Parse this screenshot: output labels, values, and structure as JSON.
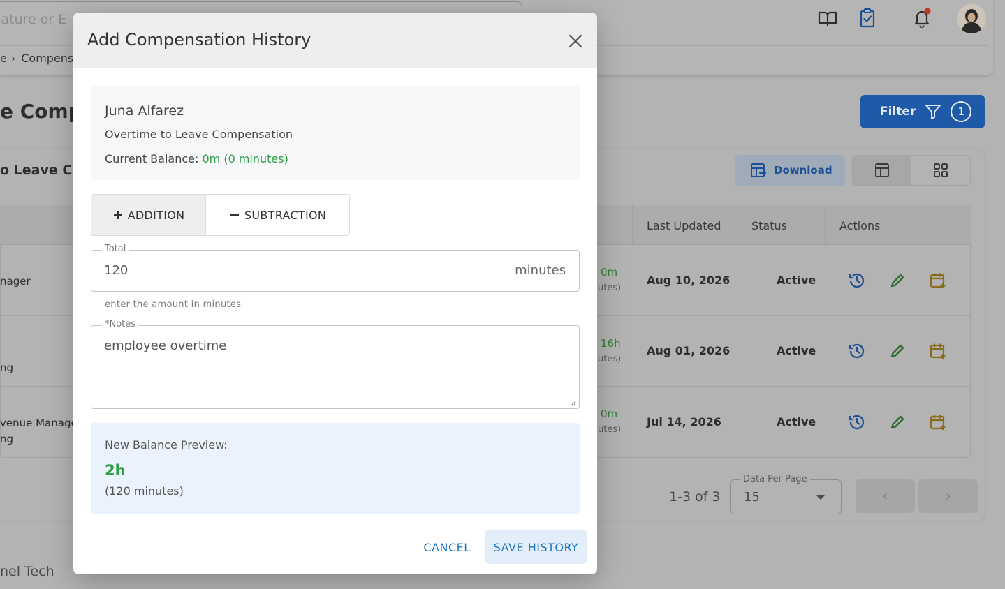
{
  "background": {
    "search_placeholder": "feature or E",
    "breadcrumb": {
      "prev": "e",
      "current": "Compens"
    },
    "page_title": "e Comp",
    "filter": {
      "label": "Filter",
      "count": "1"
    },
    "card_title": "o Leave Co",
    "download_label": "Download",
    "table": {
      "headers": {
        "last_updated": "Last Updated",
        "status": "Status",
        "actions": "Actions"
      },
      "rows": [
        {
          "left_line1": "",
          "left_line2": "nager",
          "balance": "0m",
          "balance_sub": "utes)",
          "last_updated": "Aug 10, 2026",
          "status": "Active"
        },
        {
          "left_line1": "",
          "left_line2": "ng",
          "balance": "16h",
          "balance_sub": "utes)",
          "last_updated": "Aug 01, 2026",
          "status": "Active"
        },
        {
          "left_line1": "venue Manager",
          "left_line2": "ng",
          "balance": "0m",
          "balance_sub": "utes)",
          "last_updated": "Jul 14, 2026",
          "status": "Active"
        }
      ]
    },
    "pagination": {
      "range": "1-3 of 3",
      "per_page_label": "Data Per Page",
      "per_page_value": "15"
    },
    "footer": "nel Tech"
  },
  "modal": {
    "title": "Add Compensation History",
    "employee": {
      "name": "Juna Alfarez",
      "type": "Overtime to Leave Compensation",
      "balance_label": "Current Balance: ",
      "balance_value": "0m (0 minutes)"
    },
    "toggle": {
      "addition": "ADDITION",
      "subtraction": "SUBTRACTION",
      "selected": "addition"
    },
    "total": {
      "label": "Total",
      "value": "120",
      "unit": "minutes",
      "helper": "enter the amount in minutes"
    },
    "notes": {
      "label": "*Notes",
      "value": "employee overtime"
    },
    "preview": {
      "label": "New Balance Preview:",
      "value": "2h",
      "sub": "(120 minutes)"
    },
    "buttons": {
      "cancel": "CANCEL",
      "save": "SAVE HISTORY"
    }
  },
  "colors": {
    "primary": "#1e73c4",
    "success": "#2e9e44",
    "history_icon": "#1565c0",
    "edit_icon": "#2e7d32",
    "calendar_icon": "#b7860b",
    "notification_dot": "#e53935"
  },
  "icons": [
    "book-icon",
    "clipboard-check-icon",
    "bell-icon",
    "close-icon",
    "filter-icon",
    "download-table-icon",
    "table-view-icon",
    "grid-view-icon",
    "history-icon",
    "edit-icon",
    "calendar-add-icon",
    "plus-icon",
    "minus-icon",
    "chevron-left-icon",
    "chevron-right-icon"
  ]
}
